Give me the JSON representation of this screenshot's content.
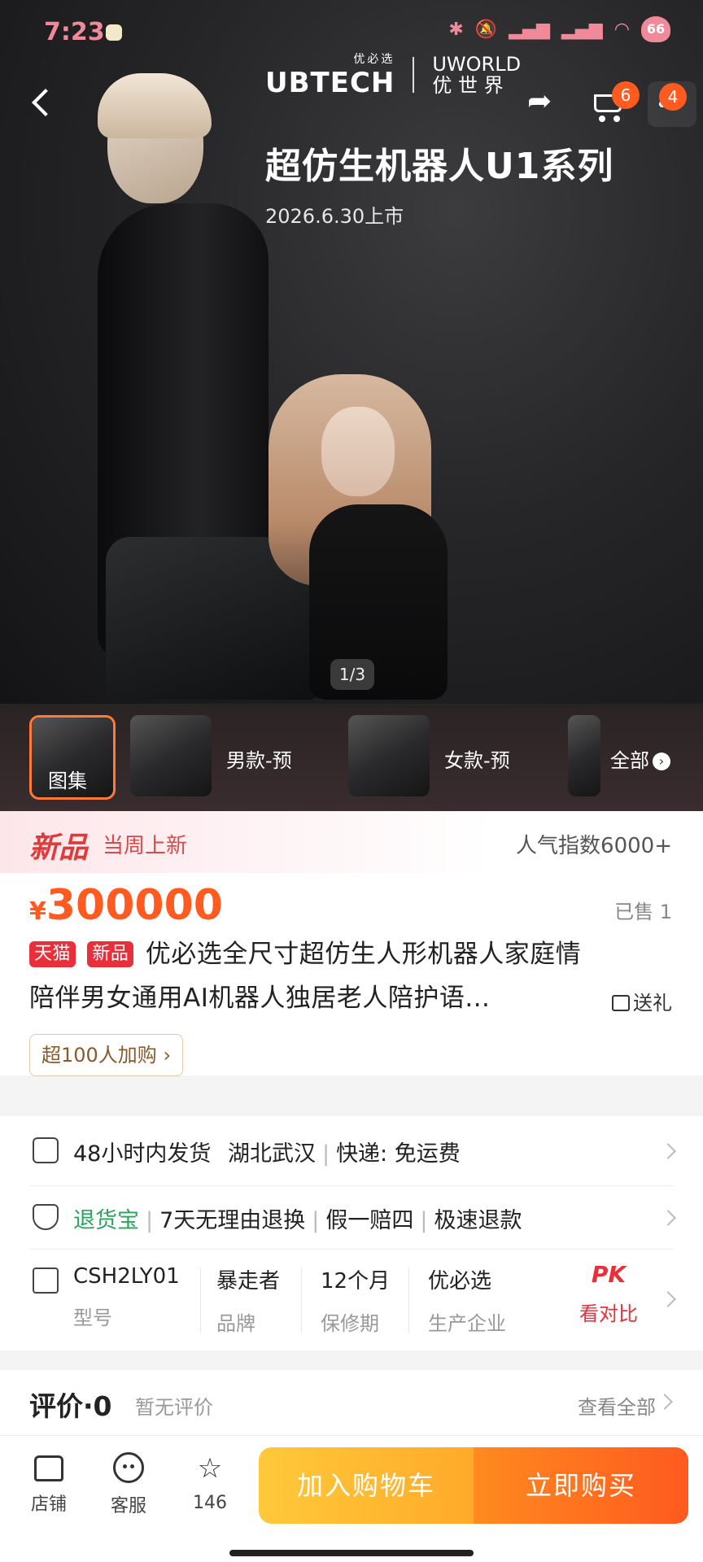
{
  "status_bar": {
    "time": "7:23",
    "battery": "66"
  },
  "brand": {
    "ubtech_cn": "优必选",
    "ubtech": "UBTECH",
    "uworld": "UWORLD",
    "uworld_cn": "优 世 界"
  },
  "header": {
    "cart_count": "6",
    "more_count": "4"
  },
  "hero": {
    "title": "超仿生机器人U1系列",
    "subtitle": "2026.6.30上市",
    "page_indicator": "1/3"
  },
  "thumbnails": [
    {
      "label": "图集",
      "active": true
    },
    {
      "label": "男款-预"
    },
    {
      "label": "女款-预"
    },
    {
      "label": "全部"
    }
  ],
  "new_strip": {
    "logo": "新品",
    "weekly": "当周上新",
    "popularity": "人气指数6000+"
  },
  "price": {
    "currency": "¥",
    "amount": "300000",
    "sold": "已售 1"
  },
  "product": {
    "tags": [
      "天猫",
      "新品"
    ],
    "title_line1": "优必选全尺寸超仿生人形机器人家庭情",
    "title_line2": "陪伴男女通用AI机器人独居老人陪护语...",
    "gift": "送礼",
    "join_button": "超100人加购"
  },
  "shipping": {
    "dispatch": "48小时内发货",
    "origin": "湖北武汉",
    "express": "快递: 免运费"
  },
  "returns": {
    "service": "退货宝",
    "policy1": "7天无理由退换",
    "policy2": "假一赔四",
    "policy3": "极速退款"
  },
  "specs": [
    {
      "value": "CSH2LY01",
      "key": "型号"
    },
    {
      "value": "暴走者",
      "key": "品牌"
    },
    {
      "value": "12个月",
      "key": "保修期"
    },
    {
      "value": "优必选",
      "key": "生产企业"
    }
  ],
  "compare": {
    "pk": "PK",
    "label": "看对比"
  },
  "reviews": {
    "title": "评价·0",
    "empty": "暂无评价",
    "view_all": "查看全部"
  },
  "bottom_bar": {
    "store": "店铺",
    "service": "客服",
    "favorites": "146",
    "add_to_cart": "加入购物车",
    "buy_now": "立即购买"
  }
}
